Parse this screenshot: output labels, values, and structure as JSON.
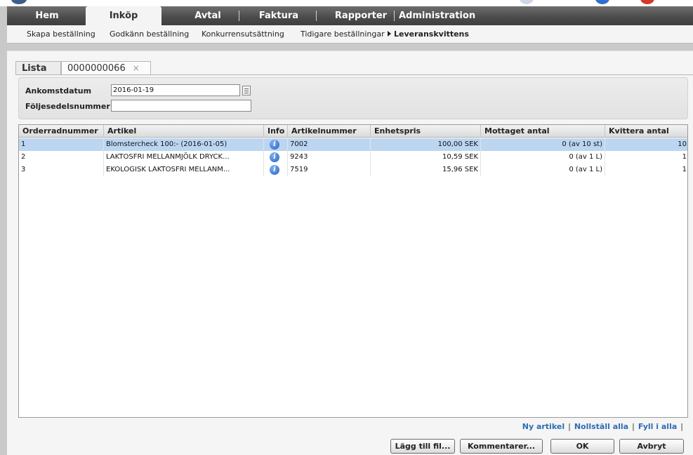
{
  "main_nav": [
    {
      "label": "Hem"
    },
    {
      "label": "Inköp"
    },
    {
      "label": "Avtal"
    },
    {
      "label": "Faktura"
    },
    {
      "label": "Rapporter"
    },
    {
      "label": "Administration"
    }
  ],
  "sub_nav": [
    {
      "label": "Skapa beställning"
    },
    {
      "label": "Godkänn beställning"
    },
    {
      "label": "Konkurrensutsättning"
    },
    {
      "label": "Tidigare beställningar"
    },
    {
      "label": "Leveranskvittens"
    }
  ],
  "page_tabs": {
    "list_label": "Lista",
    "order_label": "0000000066",
    "close_glyph": "×"
  },
  "form": {
    "arrival_date_label": "Ankomstdatum",
    "arrival_date_value": "2016-01-19",
    "delivery_note_label": "Följesedelsnummer",
    "delivery_note_value": ""
  },
  "table": {
    "columns": [
      "Orderradnummer",
      "Artikel",
      "Info",
      "Artikelnummer",
      "Enhetspris",
      "Mottaget antal",
      "Kvittera antal"
    ],
    "rows": [
      {
        "orderrad": "1",
        "artikel": "Blomstercheck 100:- (2016-01-05)",
        "artikelnummer": "7002",
        "enhetspris": "100,00 SEK",
        "mottaget": "0 (av 10 st)",
        "kvittera": "10"
      },
      {
        "orderrad": "2",
        "artikel": "LAKTOSFRI MELLANMJÖLK DRYCK...",
        "artikelnummer": "9243",
        "enhetspris": "10,59 SEK",
        "mottaget": "0 (av 1 L)",
        "kvittera": "1"
      },
      {
        "orderrad": "3",
        "artikel": "EKOLOGISK LAKTOSFRI MELLANM...",
        "artikelnummer": "7519",
        "enhetspris": "15,96 SEK",
        "mottaget": "0 (av 1 L)",
        "kvittera": "1"
      }
    ]
  },
  "links": {
    "new_article": "Ny artikel",
    "reset_all": "Nollställ alla",
    "fill_all": "Fyll i alla",
    "separator": "|"
  },
  "buttons": {
    "add_file": "Lägg till fil...",
    "comments": "Kommentarer...",
    "ok": "OK",
    "cancel": "Avbryt"
  },
  "colors": {
    "nav_dark": "#4a4a4a",
    "selected_row": "#bcd6f1",
    "link_blue": "#2e6db3",
    "info_icon": "#2a62c2"
  }
}
